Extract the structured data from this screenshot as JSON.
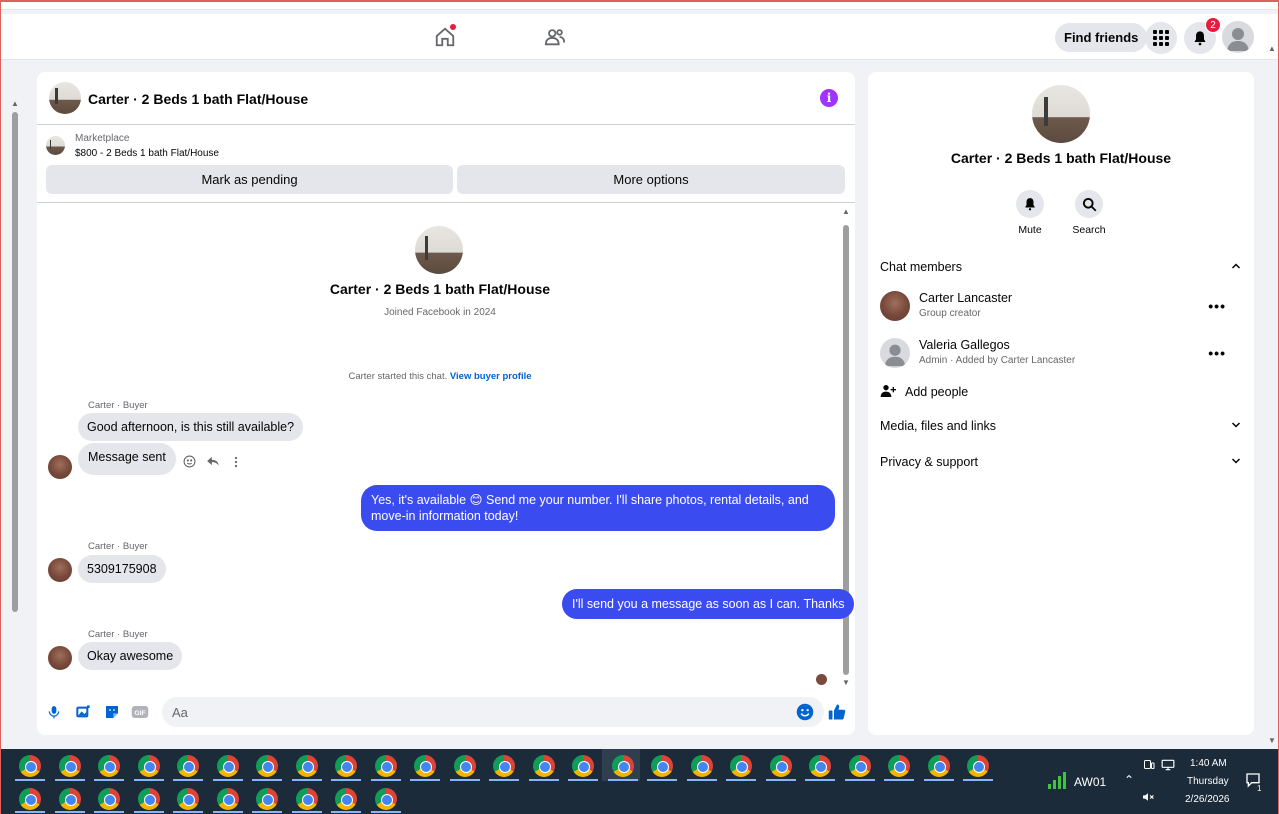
{
  "topnav": {
    "find_friends": "Find friends",
    "notification_count": "2"
  },
  "chat": {
    "title": "Carter · 2 Beds 1 bath Flat/House",
    "marketplace_label": "Marketplace",
    "listing": "$800 - 2 Beds 1 bath Flat/House",
    "mark_pending": "Mark as pending",
    "more_options": "More options",
    "intro_name": "Carter · 2 Beds 1 bath Flat/House",
    "intro_joined": "Joined Facebook in 2024",
    "started_text": "Carter started this chat.",
    "view_profile": "View buyer profile",
    "messages": [
      {
        "sender": "Carter · Buyer",
        "text": "Good afternoon, is this still available?"
      },
      {
        "text": "Message sent"
      },
      {
        "text": "Yes, it's available 😊 Send me your number. I'll share photos, rental details, and move-in information today!"
      },
      {
        "sender": "Carter · Buyer",
        "text": "5309175908"
      },
      {
        "text": "I'll send you a message as soon as I can. Thanks"
      },
      {
        "sender": "Carter · Buyer",
        "text": "Okay awesome"
      }
    ],
    "composer_placeholder": "Aa"
  },
  "side": {
    "name": "Carter · 2 Beds 1 bath Flat/House",
    "mute": "Mute",
    "search": "Search",
    "chat_members": "Chat members",
    "members": [
      {
        "name": "Carter Lancaster",
        "role": "Group creator"
      },
      {
        "name": "Valeria Gallegos",
        "role": "Admin · Added by Carter Lancaster"
      }
    ],
    "add_people": "Add people",
    "media": "Media, files and links",
    "privacy": "Privacy & support"
  },
  "taskbar": {
    "network_label": "AW01",
    "time": "1:40 AM",
    "day": "Thursday",
    "date": "2/26/2026",
    "notif_count": "1"
  },
  "colors": {
    "accent": "#3a4bf0",
    "badge": "#e41e3f",
    "info": "#a033ff",
    "link": "#0064d1"
  }
}
